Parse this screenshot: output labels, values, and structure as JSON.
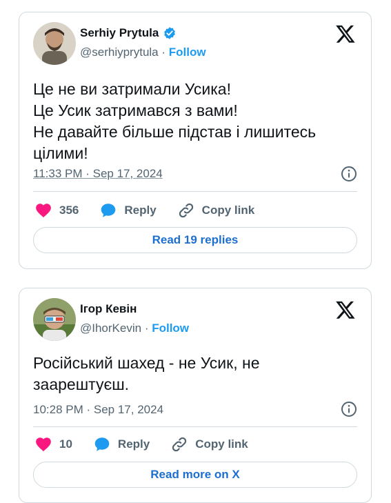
{
  "tweets": [
    {
      "author": "Serhiy Prytula",
      "handle": "@serhiyprytula",
      "follow": "Follow",
      "verified": true,
      "text": "Це не ви затримали Усика!\nЦе Усик затримався з вами!\nНе давайте більше підстав і лишитесь цілими!",
      "timestamp": "11:33 PM · Sep 17, 2024",
      "likes": "356",
      "reply": "Reply",
      "copy_link": "Copy link",
      "cta": "Read 19 replies"
    },
    {
      "author": "Ігор Кевін",
      "handle": "@IhorKevin",
      "follow": "Follow",
      "verified": false,
      "text": "Російський шахед - не Усик, не заарештуєш.",
      "timestamp": "10:28 PM · Sep 17, 2024",
      "likes": "10",
      "reply": "Reply",
      "copy_link": "Copy link",
      "cta": "Read more on X"
    }
  ],
  "colors": {
    "accent": "#1d9bf0",
    "like": "#f91880",
    "muted": "#536471",
    "border": "#cfd9de"
  },
  "icons": [
    "verified-badge-icon",
    "x-logo-icon",
    "info-icon",
    "heart-icon",
    "reply-bubble-icon",
    "link-icon"
  ]
}
